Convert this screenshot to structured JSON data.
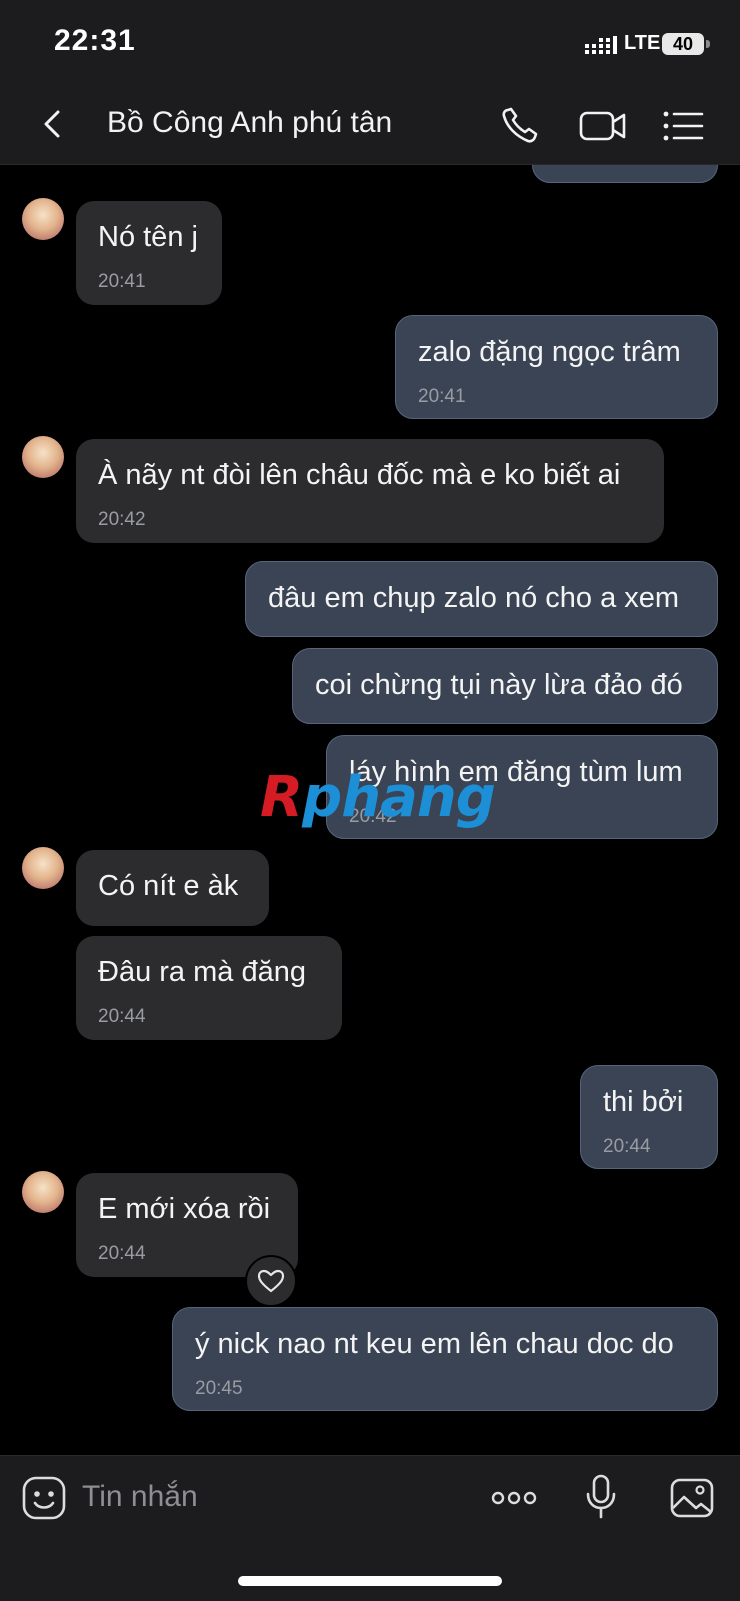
{
  "status_bar": {
    "time": "22:31",
    "network": "LTE",
    "battery": "40"
  },
  "header": {
    "title": "Bồ Công Anh phú tân",
    "icons": [
      "back-icon",
      "phone-icon",
      "video-icon",
      "menu-list-icon"
    ]
  },
  "messages": [
    {
      "side": "in",
      "text": "Nó tên j",
      "time": "20:41"
    },
    {
      "side": "out",
      "text": "zalo đặng ngọc trâm",
      "time": "20:41"
    },
    {
      "side": "in",
      "text": "À nãy nt đòi lên châu đốc mà e ko biết ai",
      "time": "20:42"
    },
    {
      "side": "out",
      "text": "đâu em chụp zalo nó cho a xem",
      "time": ""
    },
    {
      "side": "out",
      "text": "coi chừng tụi này lừa đảo đó",
      "time": ""
    },
    {
      "side": "out",
      "text": "láy hình em đăng tùm lum",
      "time": "20:42"
    },
    {
      "side": "in",
      "text": "Có nít e àk",
      "time": ""
    },
    {
      "side": "in",
      "text": "Đâu ra mà đăng",
      "time": "20:44"
    },
    {
      "side": "out",
      "text": "thi bởi",
      "time": "20:44"
    },
    {
      "side": "in",
      "text": "E mới xóa rồi",
      "time": "20:44",
      "reaction": "heart-icon"
    },
    {
      "side": "out",
      "text": "ý nick nao nt keu em lên chau doc do",
      "time": "20:45"
    }
  ],
  "watermark": {
    "first": "R",
    "rest": "phang"
  },
  "input_bar": {
    "placeholder": "Tin nhắn",
    "icons": [
      "sticker-icon",
      "more-icon",
      "microphone-icon",
      "image-icon"
    ]
  },
  "colors": {
    "background": "#000000",
    "bar": "#1c1c1e",
    "incoming_bubble": "#2c2c2e",
    "outgoing_bubble": "#3a4455",
    "outgoing_border": "#56657d",
    "timestamp": "#9a9ca2"
  }
}
